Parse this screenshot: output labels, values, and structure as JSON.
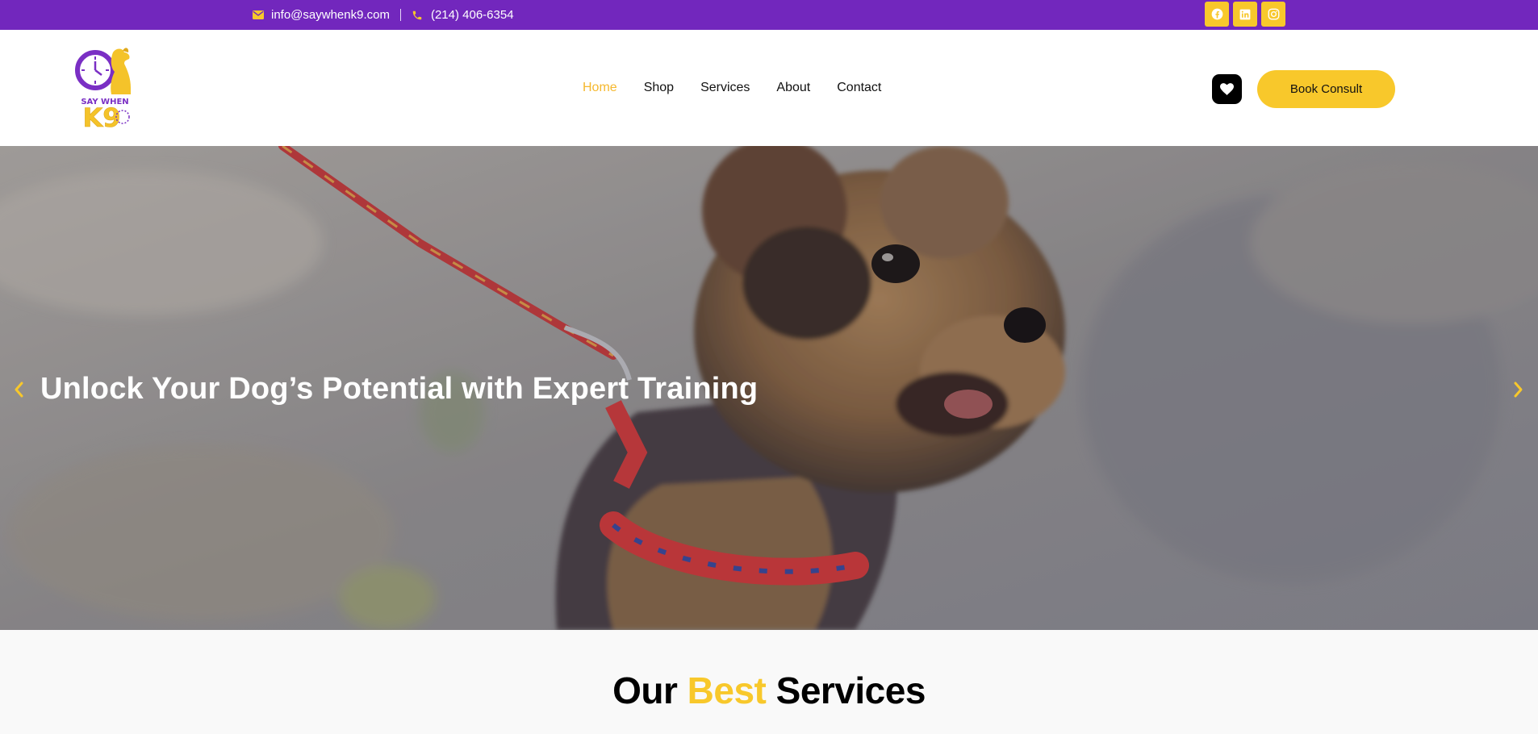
{
  "topbar": {
    "email": "info@saywhenk9.com",
    "phone": "(214) 406-6354",
    "socials": [
      "facebook-icon",
      "linkedin-icon",
      "instagram-icon"
    ]
  },
  "logo": {
    "text_line1": "SAY WHEN",
    "text_line2": "K9"
  },
  "nav": {
    "items": [
      "Home",
      "Shop",
      "Services",
      "About",
      "Contact"
    ],
    "active": "Home"
  },
  "header": {
    "book_label": "Book Consult"
  },
  "hero": {
    "heading": "Unlock Your Dog’s Potential with Expert Training"
  },
  "services": {
    "title_part1": "Our",
    "title_accent": "Best",
    "title_part2": "Services"
  },
  "colors": {
    "purple": "#7227bd",
    "yellow": "#f8c82b",
    "nav_active": "#f5b82e"
  }
}
